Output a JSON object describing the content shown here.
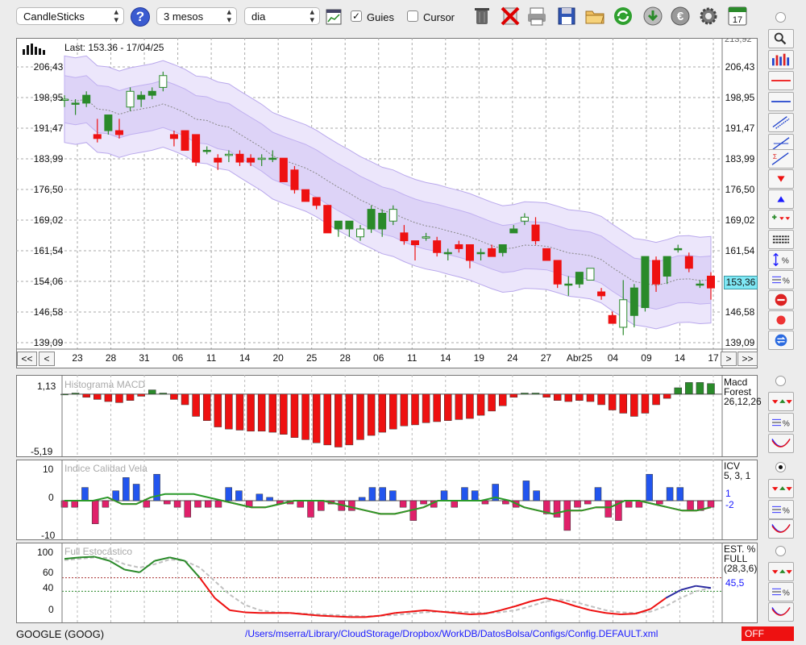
{
  "toolbar": {
    "chart_type": "CandleSticks",
    "period": "3 mesos",
    "interval": "dia",
    "guides_label": "Guies",
    "guides_checked": "✓",
    "cursor_label": "Cursor",
    "help_glyph": "?",
    "calendar_day": "17",
    "icons": [
      "help-icon",
      "chart-icon",
      "trash-icon",
      "delete-icon",
      "print-icon",
      "save-icon",
      "folder-icon",
      "refresh-icon",
      "download-icon",
      "currency-icon",
      "gear-icon",
      "calendar-icon"
    ]
  },
  "main": {
    "last_label": "Last: 153.36 - 17/04/25",
    "current_price": "153,36",
    "y_ticks": [
      "206,43",
      "198,95",
      "191,47",
      "183,99",
      "176,50",
      "169,02",
      "161,54",
      "154,06",
      "146,58",
      "139,09"
    ],
    "top_tick": "213,92",
    "x_labels": [
      "23",
      "28",
      "31",
      "06",
      "11",
      "14",
      "20",
      "25",
      "28",
      "06",
      "11",
      "14",
      "19",
      "24",
      "27",
      "Abr25",
      "04",
      "09",
      "14",
      "17"
    ],
    "nav": {
      "first": "<<",
      "prev": "<",
      "next": ">",
      "last": ">>"
    }
  },
  "macd": {
    "title": "Histograma MACD",
    "y_top": "1,13",
    "y_bottom": "-5,19",
    "legend_1": "Macd",
    "legend_2": "Forest",
    "params": "26,12,26"
  },
  "icv": {
    "title": "Indice Calidad Vela",
    "y_top": "10",
    "y_mid": "0",
    "y_bottom": "-10",
    "legend_1": "ICV",
    "params": "5, 3, 1",
    "value_1": "1",
    "value_2": "-2"
  },
  "stoch": {
    "title": "Full Estocástico",
    "y_100": "100",
    "y_60": "60",
    "y_40": "40",
    "y_0": "0",
    "legend_1": "EST. %",
    "legend_2": "FULL",
    "params": "(28,3,6)",
    "value": "45,5"
  },
  "status": {
    "symbol": "GOOGLE (GOOG)",
    "path": "/Users/mserra/Library/CloudStorage/Dropbox/WorkDB/DatosBolsa/Configs/Config.DEFAULT.xml",
    "state": "OFF"
  },
  "colors": {
    "up": "#2a8a2a",
    "down": "#ee1111",
    "band": "#e4dcfa",
    "accent": "#1a1aff"
  },
  "chart_data": [
    {
      "type": "candlestick",
      "ylim": [
        139.09,
        213.92
      ],
      "x": [
        "23",
        "28",
        "31",
        "06",
        "11",
        "14",
        "20",
        "25",
        "28",
        "06",
        "11",
        "14",
        "19",
        "24",
        "27",
        "Abr25",
        "04",
        "09",
        "14",
        "17"
      ],
      "ohlc": [
        [
          201,
          202,
          199,
          201
        ],
        [
          200,
          201,
          197,
          200
        ],
        [
          200,
          203,
          199,
          202
        ],
        [
          192,
          196,
          190,
          191
        ],
        [
          193,
          197,
          192,
          197
        ],
        [
          193,
          196,
          191,
          192
        ],
        [
          199,
          204,
          198,
          203
        ],
        [
          201,
          203,
          199,
          202
        ],
        [
          202,
          204,
          201,
          203
        ],
        [
          204,
          208,
          203,
          207
        ],
        [
          192,
          193,
          189,
          191
        ],
        [
          193,
          193,
          188,
          188
        ],
        [
          192,
          192,
          184,
          185
        ],
        [
          188,
          189,
          187,
          188
        ],
        [
          186,
          187,
          183,
          185
        ],
        [
          187,
          188,
          185,
          187
        ],
        [
          187,
          188,
          184,
          185
        ],
        [
          186,
          187,
          184,
          185
        ],
        [
          186,
          187,
          184,
          186
        ],
        [
          186,
          188,
          185,
          186
        ],
        [
          186,
          186,
          180,
          180
        ],
        [
          183,
          184,
          177,
          178
        ],
        [
          178,
          178,
          175,
          175
        ],
        [
          176,
          176,
          173,
          174
        ],
        [
          174,
          174,
          167,
          167
        ],
        [
          168,
          170,
          166,
          170
        ],
        [
          168,
          170,
          166,
          170
        ],
        [
          166,
          169,
          165,
          168
        ],
        [
          168,
          174,
          167,
          173
        ],
        [
          168,
          173,
          166,
          172
        ],
        [
          170,
          174,
          169,
          173
        ],
        [
          167,
          169,
          164,
          165
        ],
        [
          165,
          165,
          160,
          164
        ],
        [
          166,
          167,
          165,
          166
        ],
        [
          165,
          166,
          161,
          162
        ],
        [
          162,
          163,
          160,
          162
        ],
        [
          164,
          165,
          162,
          163
        ],
        [
          164,
          164,
          158,
          160
        ],
        [
          162,
          163,
          160,
          162
        ],
        [
          163,
          164,
          161,
          161
        ],
        [
          162,
          164,
          161,
          164
        ],
        [
          167,
          169,
          167,
          168
        ],
        [
          170,
          172,
          169,
          171
        ],
        [
          169,
          171,
          164,
          165
        ],
        [
          163,
          163,
          160,
          160
        ],
        [
          160,
          160,
          153,
          154
        ],
        [
          154,
          156,
          151,
          154
        ],
        [
          154,
          156,
          153,
          157
        ],
        [
          155,
          158,
          155,
          158
        ],
        [
          152,
          153,
          150,
          151
        ],
        [
          146,
          147,
          144,
          144
        ],
        [
          143,
          155,
          141,
          150
        ],
        [
          146,
          154,
          143,
          153
        ],
        [
          148,
          161,
          147,
          161
        ],
        [
          160,
          161,
          152,
          154
        ],
        [
          156,
          161,
          154,
          161
        ],
        [
          163,
          164,
          162,
          163
        ],
        [
          161,
          162,
          157,
          158
        ],
        [
          154,
          155,
          153,
          154
        ],
        [
          156,
          157,
          150,
          153
        ]
      ]
    },
    {
      "type": "bar",
      "title": "Histograma MACD",
      "ylim": [
        -5.19,
        1.13
      ],
      "values": [
        0,
        0.1,
        -0.3,
        -0.5,
        -0.7,
        -0.8,
        -0.6,
        -0.2,
        0.4,
        0.1,
        -0.5,
        -1.0,
        -2.1,
        -2.5,
        -3.1,
        -3.3,
        -3.4,
        -3.5,
        -3.5,
        -3.6,
        -3.8,
        -4.1,
        -4.3,
        -4.6,
        -4.8,
        -5.0,
        -4.8,
        -4.3,
        -3.9,
        -3.6,
        -3.3,
        -3.0,
        -2.9,
        -2.7,
        -2.6,
        -2.5,
        -2.4,
        -2.3,
        -2.0,
        -1.6,
        -1.1,
        -0.3,
        0.1,
        0.1,
        -0.3,
        -0.6,
        -0.7,
        -0.6,
        -0.7,
        -1.0,
        -1.5,
        -1.8,
        -2.1,
        -1.8,
        -1.0,
        -0.4,
        0.6,
        1.1,
        1.1,
        1.0
      ]
    },
    {
      "type": "bar",
      "title": "Indice Calidad Vela",
      "ylim": [
        -10,
        10
      ],
      "values": [
        -2,
        -2,
        4,
        -7,
        -2,
        3,
        7,
        5,
        -2,
        8,
        -1,
        -2,
        -5,
        -2,
        -2,
        -2,
        4,
        3,
        -2,
        2,
        1,
        -1,
        -1,
        -2,
        -5,
        -3,
        -1,
        -3,
        -3,
        1,
        4,
        4,
        3,
        -2,
        -6,
        -1,
        -2,
        3,
        -2,
        4,
        3,
        -1,
        5,
        -1,
        -2,
        6,
        3,
        -4,
        -5,
        -9,
        -2,
        -1,
        4,
        -5,
        -6,
        -2,
        -2,
        8,
        -1,
        4,
        4,
        -3,
        -3,
        -2
      ],
      "series": [
        {
          "name": "ICV",
          "values": [
            0,
            0,
            0,
            1,
            -1,
            -1,
            1,
            2,
            2,
            2,
            1,
            0,
            -1,
            -2,
            -2,
            -1,
            0,
            0,
            0,
            -1,
            -2,
            -3,
            -4,
            -4,
            -3,
            -2,
            0,
            0,
            0,
            0,
            1,
            0,
            -2,
            -3,
            -4,
            -3,
            -3,
            -2,
            -2,
            0,
            0,
            -1,
            -2,
            -3,
            -3,
            -2
          ]
        }
      ]
    },
    {
      "type": "line",
      "title": "Full Estocástico",
      "ylim": [
        0,
        100
      ],
      "series": [
        {
          "name": "%K",
          "values": [
            88,
            90,
            91,
            85,
            72,
            68,
            85,
            90,
            85,
            60,
            30,
            12,
            9,
            8,
            8,
            8,
            6,
            4,
            3,
            2,
            2,
            4,
            8,
            10,
            12,
            10,
            8,
            6,
            7,
            12,
            18,
            25,
            30,
            25,
            18,
            12,
            8,
            6,
            7,
            14,
            30,
            42,
            48,
            45
          ]
        },
        {
          "name": "%D",
          "values": [
            86,
            88,
            90,
            89,
            80,
            75,
            80,
            87,
            85,
            75,
            55,
            35,
            20,
            12,
            9,
            8,
            7,
            6,
            5,
            4,
            3,
            4,
            5,
            7,
            9,
            10,
            10,
            9,
            8,
            9,
            12,
            18,
            25,
            28,
            24,
            18,
            12,
            9,
            8,
            10,
            18,
            30,
            40,
            45
          ]
        }
      ]
    }
  ]
}
